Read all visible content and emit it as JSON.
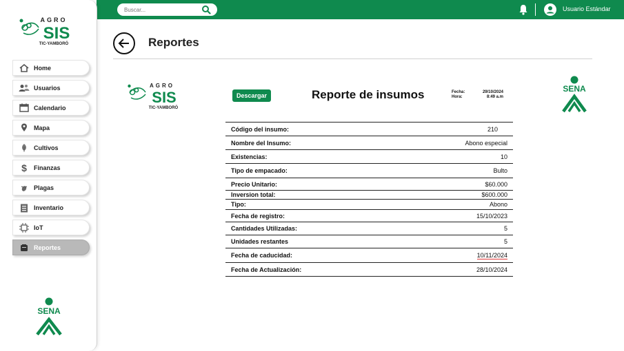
{
  "topbar": {
    "search_placeholder": "Buscar...",
    "user_name": "Usuario Estándar"
  },
  "sidebar": {
    "logo_top": "AGRO",
    "logo_main": "SIS",
    "logo_sub": "TIC-YAMBORÓ",
    "items": [
      {
        "label": "Home",
        "icon": "home-icon"
      },
      {
        "label": "Usuarios",
        "icon": "users-icon"
      },
      {
        "label": "Calendario",
        "icon": "calendar-icon"
      },
      {
        "label": "Mapa",
        "icon": "map-pin-icon"
      },
      {
        "label": "Cultivos",
        "icon": "leaf-icon"
      },
      {
        "label": "Finanzas",
        "icon": "dollar-icon"
      },
      {
        "label": "Plagas",
        "icon": "bug-icon"
      },
      {
        "label": "Inventario",
        "icon": "clipboard-icon"
      },
      {
        "label": "IoT",
        "icon": "chip-icon"
      },
      {
        "label": "Reportes",
        "icon": "report-icon",
        "active": true
      }
    ],
    "sena_text": "SENA"
  },
  "page": {
    "title": "Reportes"
  },
  "report": {
    "logo_top": "AGRO",
    "logo_main": "SIS",
    "logo_sub": "TIC-YAMBORÓ",
    "download_label": "Descargar",
    "title": "Reporte de insumos",
    "fecha_label": "Fecha:",
    "fecha_value": "29/10/2024",
    "hora_label": "Hora:",
    "hora_value": "8:49 a.m",
    "sena_text": "SENA",
    "rows": [
      {
        "label": "Código del insumo:",
        "value": "210"
      },
      {
        "label": "Nombre del Insumo:",
        "value": "Abono especial"
      },
      {
        "label": "Existencias:",
        "value": "10"
      },
      {
        "label": "Tipo de empacado:",
        "value": "Bulto"
      },
      {
        "label": "Precio Unitario:",
        "value": "$60.000"
      },
      {
        "label": "Inversion  total:",
        "value": "$600.000"
      },
      {
        "label": "Tipo:",
        "value": "Abono"
      },
      {
        "label": "Fecha de registro:",
        "value": "15/10/2023"
      },
      {
        "label": "Cantidades Utilizadas:",
        "value": "5"
      },
      {
        "label": "Unidades restantes",
        "value": "5"
      },
      {
        "label": "Fecha de caducidad:",
        "value": "10/11/2024"
      },
      {
        "label": "Fecha de Actualización:",
        "value": "28/10/2024"
      }
    ]
  },
  "colors": {
    "brand_green": "#0f8a4e",
    "active_nav": "#b9b9b9"
  }
}
